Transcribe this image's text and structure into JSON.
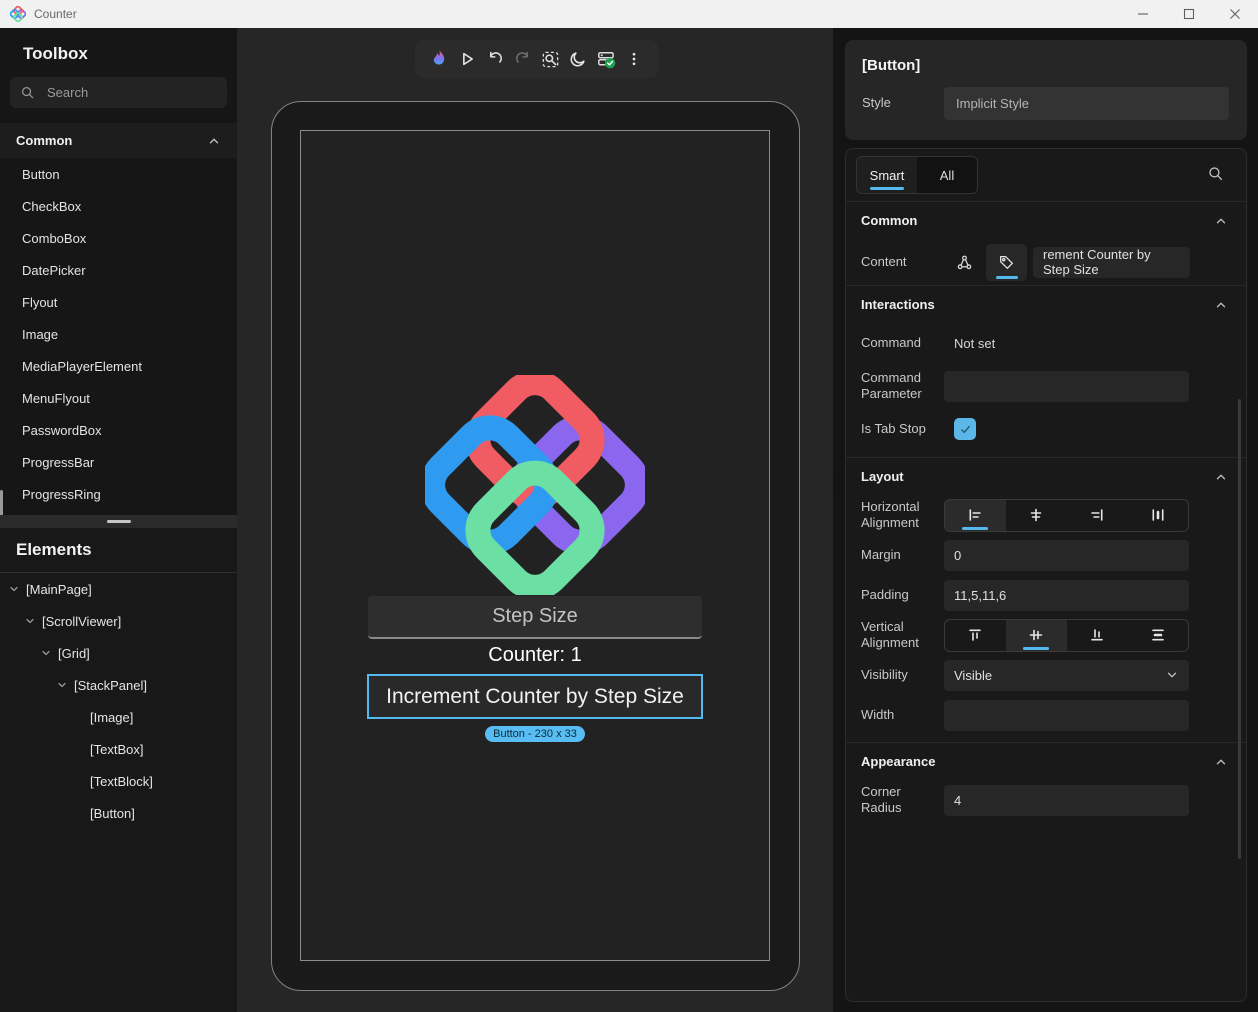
{
  "window": {
    "title": "Counter",
    "controls": [
      "minimize",
      "maximize",
      "close"
    ]
  },
  "toolbox": {
    "title": "Toolbox",
    "search_placeholder": "Search",
    "group_label": "Common",
    "items": [
      "Button",
      "CheckBox",
      "ComboBox",
      "DatePicker",
      "Flyout",
      "Image",
      "MediaPlayerElement",
      "MenuFlyout",
      "PasswordBox",
      "ProgressBar",
      "ProgressRing"
    ]
  },
  "elements": {
    "title": "Elements",
    "tree": [
      {
        "label": "[MainPage]",
        "level": 0,
        "expandable": true
      },
      {
        "label": "[ScrollViewer]",
        "level": 1,
        "expandable": true
      },
      {
        "label": "[Grid]",
        "level": 2,
        "expandable": true
      },
      {
        "label": "[StackPanel]",
        "level": 3,
        "expandable": true
      },
      {
        "label": "[Image]",
        "level": 4,
        "expandable": false
      },
      {
        "label": "[TextBox]",
        "level": 4,
        "expandable": false
      },
      {
        "label": "[TextBlock]",
        "level": 4,
        "expandable": false
      },
      {
        "label": "[Button]",
        "level": 4,
        "expandable": false
      }
    ]
  },
  "toolbar": {
    "icons": [
      "hot-reload-flame",
      "play",
      "undo",
      "redo",
      "inspect",
      "theme-moon",
      "status-connected",
      "more-options"
    ]
  },
  "canvas": {
    "textbox_placeholder": "Step Size",
    "counter_text": "Counter: 1",
    "button_label": "Increment Counter by Step Size",
    "selection_badge": "Button - 230 x 33"
  },
  "properties": {
    "header_title": "[Button]",
    "style_label": "Style",
    "style_value": "Implicit Style",
    "tabs": {
      "smart": "Smart",
      "all": "All"
    },
    "common": {
      "title": "Common",
      "content_label": "Content",
      "content_value": "rement Counter by Step Size"
    },
    "interactions": {
      "title": "Interactions",
      "command_label": "Command",
      "command_value": "Not set",
      "command_parameter_label": "Command Parameter",
      "command_parameter_value": "",
      "is_tab_stop_label": "Is Tab Stop",
      "is_tab_stop_checked": true
    },
    "layout": {
      "title": "Layout",
      "horizontal_alignment_label": "Horizontal Alignment",
      "horizontal_alignment_selected": "left",
      "margin_label": "Margin",
      "margin_value": "0",
      "padding_label": "Padding",
      "padding_value": "11,5,11,6",
      "vertical_alignment_label": "Vertical Alignment",
      "vertical_alignment_selected": "center",
      "visibility_label": "Visibility",
      "visibility_value": "Visible",
      "width_label": "Width",
      "width_value": ""
    },
    "appearance": {
      "title": "Appearance",
      "corner_radius_label": "Corner Radius",
      "corner_radius_value": "4"
    }
  },
  "colors": {
    "accent": "#53B9EE",
    "badge_bg": "#57BDF2",
    "status_green": "#1E9E4F",
    "titlebar_bg": "#F1F1F1",
    "canvas_bg": "#262626",
    "panel_bg": "#161616",
    "logo_red": "#F15C63",
    "logo_blue": "#2E9BF0",
    "logo_purple": "#8B66EE",
    "logo_green": "#6CDFA4"
  }
}
